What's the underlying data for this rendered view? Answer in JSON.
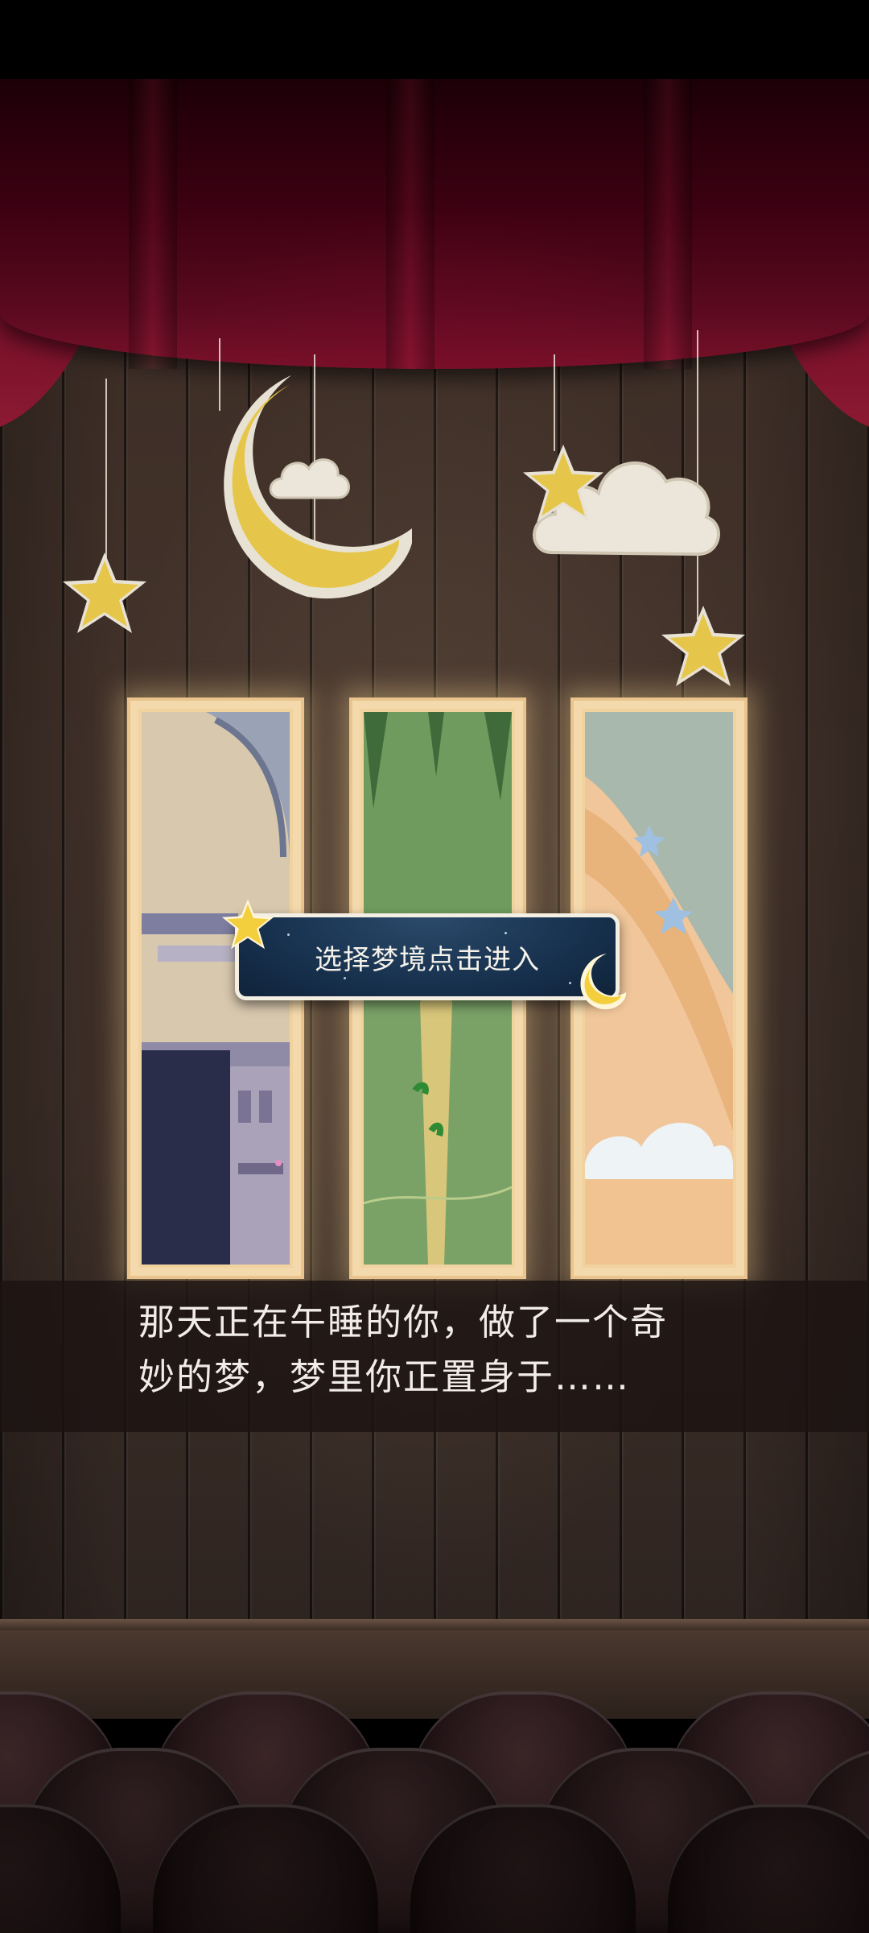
{
  "tooltip": {
    "text": "选择梦境点击进入"
  },
  "narration": {
    "line1": "那天正在午睡的你，做了一个奇",
    "line2": "妙的梦，梦里你正置身于……"
  },
  "dream_panels": [
    {
      "name": "dream-city"
    },
    {
      "name": "dream-forest"
    },
    {
      "name": "dream-sky"
    }
  ],
  "icons": [
    "star-icon",
    "moon-icon",
    "cloud-icon"
  ],
  "colors": {
    "curtain": "#5b0a1f",
    "wall": "#43332b",
    "felt_yellow": "#e6c64a",
    "tooltip_bg": "#17314e",
    "panel_frame": "#f1d3a0"
  }
}
